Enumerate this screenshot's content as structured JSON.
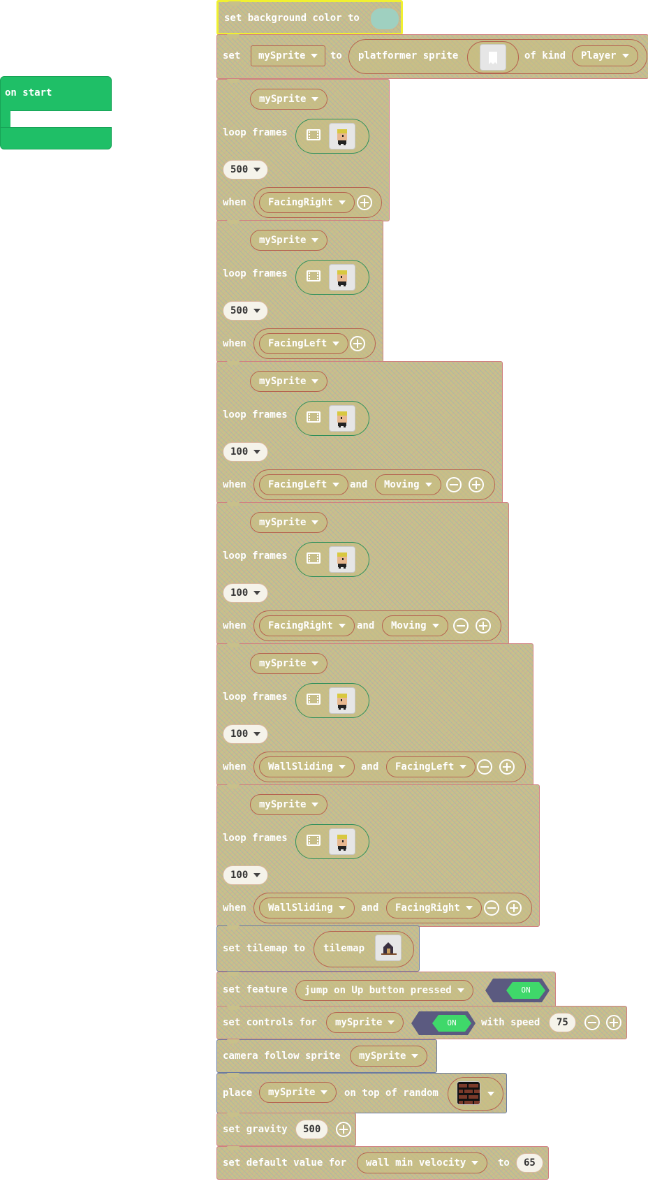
{
  "on_start": {
    "label": "on start"
  },
  "kw": {
    "set": "set",
    "to": "to",
    "loop_frames": "loop frames",
    "when": "when",
    "and": "and",
    "of_kind": "of kind",
    "with_speed": "with speed",
    "on_top_of_random": "on top of random"
  },
  "bg_block": {
    "label": "set background color to",
    "color": "#9fd0c0"
  },
  "create_sprite": {
    "var": "mySprite",
    "sprite_label": "platformer sprite",
    "kind": "Player"
  },
  "anim_blocks": [
    {
      "sprite": "mySprite",
      "interval": "500",
      "conds": [
        "FacingRight"
      ],
      "facing": "right"
    },
    {
      "sprite": "mySprite",
      "interval": "500",
      "conds": [
        "FacingLeft"
      ],
      "facing": "left"
    },
    {
      "sprite": "mySprite",
      "interval": "100",
      "conds": [
        "FacingLeft",
        "Moving"
      ],
      "facing": "left"
    },
    {
      "sprite": "mySprite",
      "interval": "100",
      "conds": [
        "FacingRight",
        "Moving"
      ],
      "facing": "right"
    },
    {
      "sprite": "mySprite",
      "interval": "100",
      "conds": [
        "WallSliding",
        "FacingLeft"
      ],
      "facing": "left"
    },
    {
      "sprite": "mySprite",
      "interval": "100",
      "conds": [
        "WallSliding",
        "FacingRight"
      ],
      "facing": "right"
    }
  ],
  "tilemap_block": {
    "label": "set tilemap to",
    "value": "tilemap"
  },
  "feature_block": {
    "label": "set feature",
    "feature": "jump on Up button pressed",
    "toggle": "ON"
  },
  "controls_block": {
    "label": "set controls for",
    "sprite": "mySprite",
    "toggle": "ON",
    "speed": "75"
  },
  "camera_block": {
    "label": "camera follow sprite",
    "sprite": "mySprite"
  },
  "place_block": {
    "label": "place",
    "sprite": "mySprite"
  },
  "gravity_block": {
    "label": "set gravity",
    "value": "500"
  },
  "default_block": {
    "label": "set default value for",
    "prop": "wall min velocity",
    "value": "65"
  },
  "colors": {
    "hat_green": "#1fbf67",
    "block_olive": "#c8c08a",
    "toggle_on": "#3fd86a",
    "toggle_bg": "#5b5a80"
  }
}
